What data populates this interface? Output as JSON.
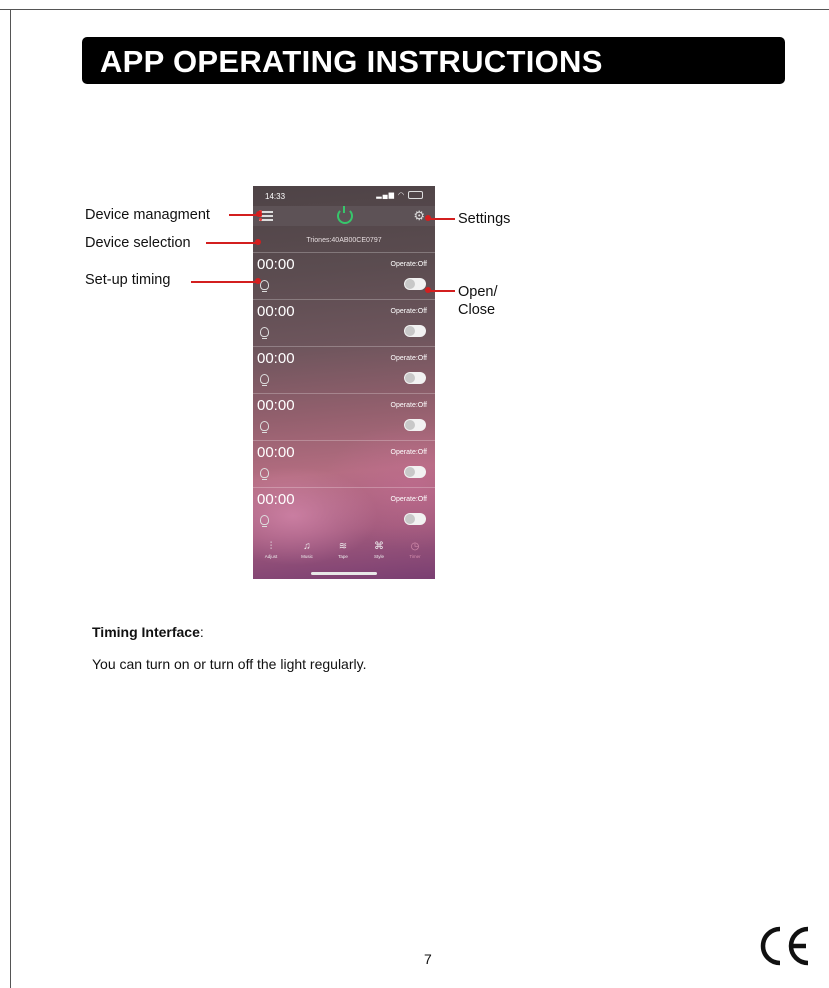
{
  "banner": {
    "title": "APP OPERATING INSTRUCTIONS"
  },
  "phone": {
    "status_time": "14:33",
    "device_id": "Triones:40AB00CE0797",
    "timers": [
      {
        "time": "00:00",
        "operate": "Operate:Off",
        "enabled": false
      },
      {
        "time": "00:00",
        "operate": "Operate:Off",
        "enabled": false
      },
      {
        "time": "00:00",
        "operate": "Operate:Off",
        "enabled": false
      },
      {
        "time": "00:00",
        "operate": "Operate:Off",
        "enabled": false
      },
      {
        "time": "00:00",
        "operate": "Operate:Off",
        "enabled": false
      },
      {
        "time": "00:00",
        "operate": "Operate:Off",
        "enabled": false
      }
    ],
    "tabs": [
      {
        "label": "Adjust",
        "icon": "sliders-icon"
      },
      {
        "label": "Music",
        "icon": "music-note-icon"
      },
      {
        "label": "Tape",
        "icon": "tape-icon"
      },
      {
        "label": "Style",
        "icon": "style-icon"
      },
      {
        "label": "Timer",
        "icon": "clock-icon"
      }
    ],
    "colors": {
      "power": "#37c66b",
      "active_tab": "#d68fae"
    }
  },
  "callouts": {
    "device_management": "Device managment",
    "device_selection": "Device selection",
    "setup_timing": "Set-up timing",
    "settings": "Settings",
    "open_close_1": "Open/",
    "open_close_2": "Close",
    "leader_color": "#d31f1f"
  },
  "caption": {
    "heading": "Timing Interface",
    "colon": ":",
    "body": "You can turn on or turn off the light regularly."
  },
  "page_number": "7",
  "certification_mark": "CE"
}
